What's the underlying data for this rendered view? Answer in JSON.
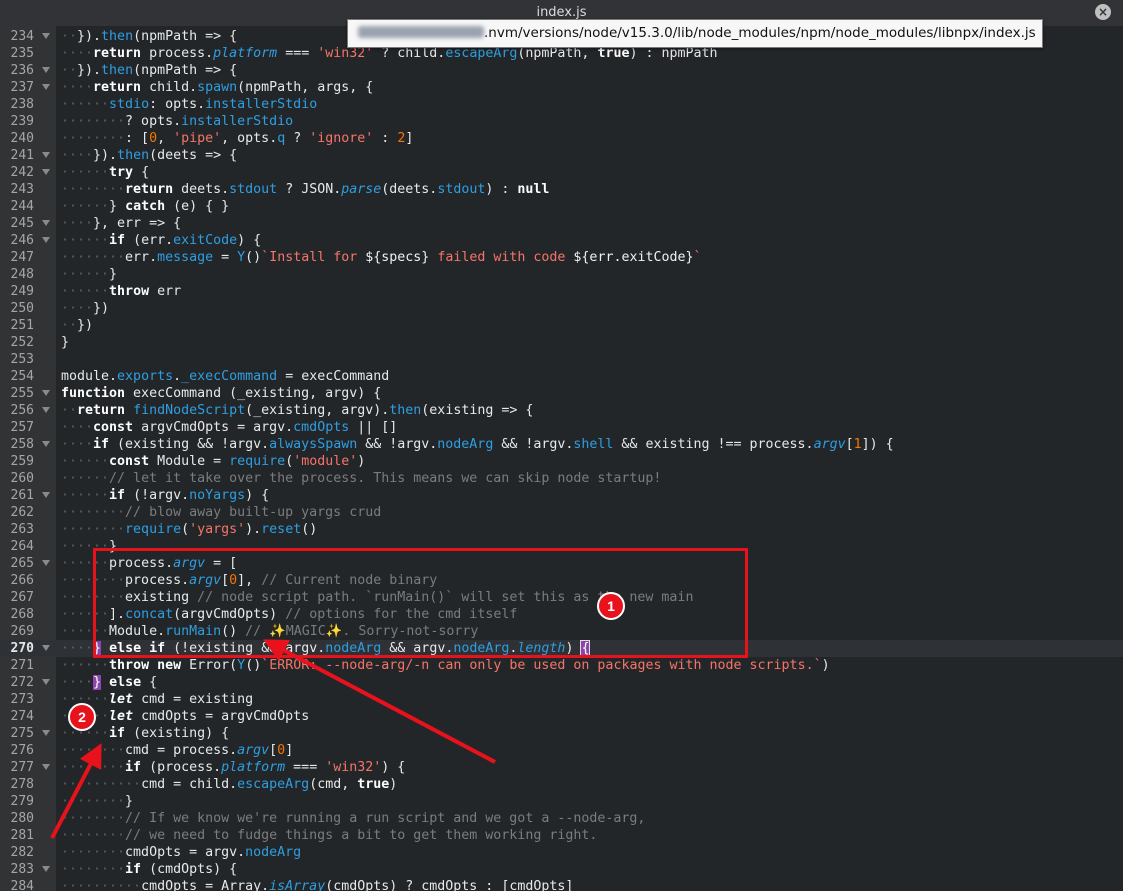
{
  "window": {
    "title": "index.js",
    "close_symbol": "×"
  },
  "tooltip": {
    "path": ".nvm/versions/node/v15.3.0/lib/node_modules/npm/node_modules/libnpx/index.js"
  },
  "annotations": {
    "badge1": "1",
    "badge2": "2",
    "color": "#e8121c"
  },
  "colors": {
    "keyword": "#fdfdfd",
    "property": "#2f9ee0",
    "string": "#f67467",
    "number": "#f67400",
    "comment": "#7a7c7d",
    "background": "#232629",
    "gutter": "#313335"
  },
  "editor": {
    "current_line": 270,
    "lines": [
      {
        "n": 234,
        "fold": true,
        "code": "··}).then(npmPath => {"
      },
      {
        "n": 235,
        "code": "····return process.platform === 'win32' ? child.escapeArg(npmPath, true) : npmPath"
      },
      {
        "n": 236,
        "fold": true,
        "code": "··}).then(npmPath => {"
      },
      {
        "n": 237,
        "fold": true,
        "code": "····return child.spawn(npmPath, args, {"
      },
      {
        "n": 238,
        "code": "······stdio: opts.installerStdio"
      },
      {
        "n": 239,
        "code": "········? opts.installerStdio"
      },
      {
        "n": 240,
        "code": "········: [0, 'pipe', opts.q ? 'ignore' : 2]"
      },
      {
        "n": 241,
        "fold": true,
        "code": "····}).then(deets => {"
      },
      {
        "n": 242,
        "fold": true,
        "code": "······try {"
      },
      {
        "n": 243,
        "code": "········return deets.stdout ? JSON.parse(deets.stdout) : null"
      },
      {
        "n": 244,
        "code": "······} catch (e) { }"
      },
      {
        "n": 245,
        "fold": true,
        "code": "····}, err => {"
      },
      {
        "n": 246,
        "fold": true,
        "code": "······if (err.exitCode) {"
      },
      {
        "n": 247,
        "code": "········err.message = Y()`Install for ${specs} failed with code ${err.exitCode}`"
      },
      {
        "n": 248,
        "code": "······}"
      },
      {
        "n": 249,
        "code": "······throw err"
      },
      {
        "n": 250,
        "code": "····})"
      },
      {
        "n": 251,
        "code": "··})"
      },
      {
        "n": 252,
        "code": "}"
      },
      {
        "n": 253,
        "code": ""
      },
      {
        "n": 254,
        "code": "module.exports._execCommand = execCommand"
      },
      {
        "n": 255,
        "fold": true,
        "code": "function execCommand (_existing, argv) {"
      },
      {
        "n": 256,
        "fold": true,
        "code": "··return findNodeScript(_existing, argv).then(existing => {"
      },
      {
        "n": 257,
        "code": "····const argvCmdOpts = argv.cmdOpts || []"
      },
      {
        "n": 258,
        "fold": true,
        "code": "····if (existing && !argv.alwaysSpawn && !argv.nodeArg && !argv.shell && existing !== process.argv[1]) {"
      },
      {
        "n": 259,
        "code": "······const Module = require('module')"
      },
      {
        "n": 260,
        "code": "······// let it take over the process. This means we can skip node startup!"
      },
      {
        "n": 261,
        "fold": true,
        "code": "······if (!argv.noYargs) {"
      },
      {
        "n": 262,
        "code": "········// blow away built-up yargs crud"
      },
      {
        "n": 263,
        "code": "········require('yargs').reset()"
      },
      {
        "n": 264,
        "code": "······}"
      },
      {
        "n": 265,
        "fold": true,
        "code": "······process.argv = ["
      },
      {
        "n": 266,
        "code": "········process.argv[0], // Current node binary"
      },
      {
        "n": 267,
        "code": "········existing // node script path. `runMain()` will set this as the new main"
      },
      {
        "n": 268,
        "code": "······].concat(argvCmdOpts) // options for the cmd itself"
      },
      {
        "n": 269,
        "code": "······Module.runMain() // ✨MAGIC✨. Sorry-not-sorry"
      },
      {
        "n": 270,
        "fold": true,
        "code": "····} else if (!existing && argv.nodeArg && argv.nodeArg.length) {"
      },
      {
        "n": 271,
        "code": "······throw new Error(Y()`ERROR: --node-arg/-n can only be used on packages with node scripts.`)"
      },
      {
        "n": 272,
        "fold": true,
        "code": "····} else {"
      },
      {
        "n": 273,
        "code": "······let cmd = existing"
      },
      {
        "n": 274,
        "code": "······let cmdOpts = argvCmdOpts"
      },
      {
        "n": 275,
        "fold": true,
        "code": "······if (existing) {"
      },
      {
        "n": 276,
        "code": "········cmd = process.argv[0]"
      },
      {
        "n": 277,
        "fold": true,
        "code": "········if (process.platform === 'win32') {"
      },
      {
        "n": 278,
        "code": "··········cmd = child.escapeArg(cmd, true)"
      },
      {
        "n": 279,
        "code": "········}"
      },
      {
        "n": 280,
        "code": "········// If we know we're running a run script and we got a --node-arg,"
      },
      {
        "n": 281,
        "code": "········// we need to fudge things a bit to get them working right."
      },
      {
        "n": 282,
        "code": "········cmdOpts = argv.nodeArg"
      },
      {
        "n": 283,
        "fold": true,
        "code": "········if (cmdOpts) {"
      },
      {
        "n": 284,
        "code": "··········cmdOpts = Array.isArray(cmdOpts) ? cmdOpts : [cmdOpts]"
      }
    ]
  }
}
